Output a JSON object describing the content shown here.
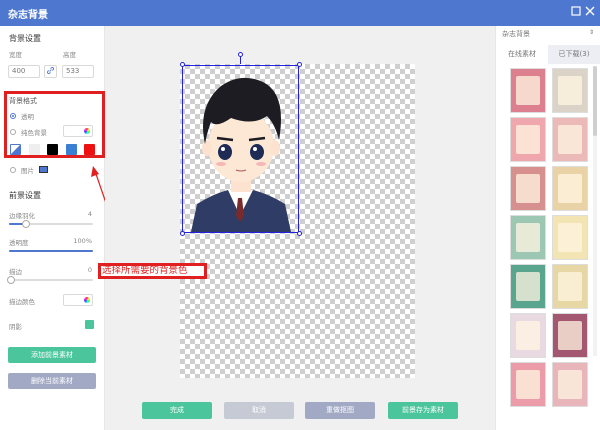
{
  "window": {
    "title": "杂志背景"
  },
  "background_settings": {
    "heading": "背景设置",
    "width_label": "宽度",
    "height_label": "高度",
    "width_value": "400",
    "height_value": "533",
    "style_heading": "背景格式",
    "transparent_label": "透明",
    "solid_label": "纯色背景",
    "image_label": "图片",
    "swatches": [
      "#eeeeee",
      "#000000",
      "#3b7fd4",
      "#ee1111"
    ]
  },
  "foreground_settings": {
    "heading": "前景设置",
    "edge_feather_label": "边缘羽化",
    "edge_feather_value": "4",
    "opacity_label": "透明度",
    "opacity_value": "100%",
    "stroke_label": "描边",
    "stroke_value": "0",
    "stroke_color_label": "描边颜色",
    "shadow_label": "阴影"
  },
  "buttons": {
    "add_foreground": "添加前景素材",
    "delete_foreground": "删除当前素材",
    "done": "完成",
    "cancel": "取消",
    "redo_cutout": "重做抠图",
    "save_foreground": "前景存为素材"
  },
  "annotation": {
    "text": "选择所需要的背景色"
  },
  "right_panel": {
    "category": "杂志背景",
    "tab_online": "在线素材",
    "tab_downloaded": "已下载(3)",
    "thumbs_col1": [
      "#dc7f8f",
      "#efa7ad",
      "#d6908d",
      "#9cc7b2",
      "#59a58d",
      "#e9dae2",
      "#ec9ba9"
    ],
    "thumbs_col2": [
      "#dbd3c7",
      "#ecb9b9",
      "#e9d3a6",
      "#f2e4b3",
      "#e7d7a5",
      "#a35770",
      "#e8b5ba"
    ],
    "colors": {
      "accent": "#4e77cf",
      "green_button": "#4bc59b",
      "gray_button": "#a2a9c5",
      "annotation_red": "#e02020"
    }
  }
}
